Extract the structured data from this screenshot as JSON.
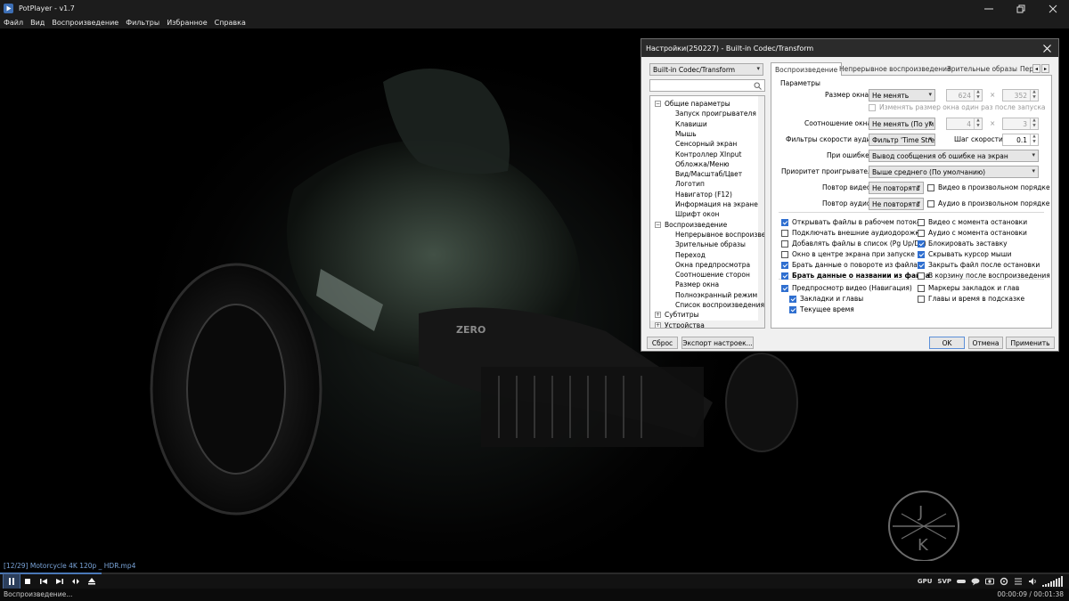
{
  "window": {
    "title": "PotPlayer - v1.7"
  },
  "menu": [
    "Файл",
    "Вид",
    "Воспроизведение",
    "Фильтры",
    "Избранное",
    "Справка"
  ],
  "video": {
    "watermark_letters": [
      "J",
      "K"
    ]
  },
  "filename": "[12/29] Motorcycle 4K 120p _ HDR.mp4",
  "progress": {
    "fraction": 0.095
  },
  "controls": {
    "right_labels": [
      "GPU",
      "SVP"
    ]
  },
  "status": {
    "left": "Воспроизведение...",
    "time": "00:00:09 / 00:01:38"
  },
  "dialog": {
    "title": "Настройки(250227) - Built-in Codec/Transform",
    "profile_combo": "Built-in Codec/Transform",
    "search_placeholder": "",
    "tree": [
      {
        "label": "Общие параметры",
        "level": 0,
        "toggle": "−"
      },
      {
        "label": "Запуск проигрывателя",
        "level": 1
      },
      {
        "label": "Клавиши",
        "level": 1
      },
      {
        "label": "Мышь",
        "level": 1
      },
      {
        "label": "Сенсорный экран",
        "level": 1
      },
      {
        "label": "Контроллер XInput",
        "level": 1
      },
      {
        "label": "Обложка/Меню",
        "level": 1
      },
      {
        "label": "Вид/Масштаб/Цвет",
        "level": 1
      },
      {
        "label": "Логотип",
        "level": 1
      },
      {
        "label": "Навигатор (F12)",
        "level": 1
      },
      {
        "label": "Информация на экране",
        "level": 1
      },
      {
        "label": "Шрифт окон",
        "level": 1
      },
      {
        "label": "Воспроизведение",
        "level": 0,
        "toggle": "−"
      },
      {
        "label": "Непрерывное воспроизве",
        "level": 1
      },
      {
        "label": "Зрительные образы",
        "level": 1
      },
      {
        "label": "Переход",
        "level": 1
      },
      {
        "label": "Окна предпросмотра",
        "level": 1
      },
      {
        "label": "Соотношение сторон",
        "level": 1
      },
      {
        "label": "Размер окна",
        "level": 1
      },
      {
        "label": "Полноэкранный режим",
        "level": 1
      },
      {
        "label": "Список воспроизведения",
        "level": 1
      },
      {
        "label": "Субтитры",
        "level": 0,
        "toggle": "+"
      },
      {
        "label": "Устройства",
        "level": 0,
        "toggle": "+"
      }
    ],
    "tabs": [
      "Воспроизведение",
      "Непрерывное воспроизведение",
      "Зрительные образы",
      "Пер"
    ],
    "group_title": "Параметры",
    "window_size": {
      "label": "Размер окна:",
      "value": "Не менять",
      "width": "624",
      "height": "352",
      "x_sep": "×",
      "resize_once": "Изменять размер окна один раз после запуска"
    },
    "aspect": {
      "label": "Соотношение окна:",
      "value": "Не менять (По ум",
      "w": "4",
      "h": "3",
      "x_sep": "×"
    },
    "audio_filter": {
      "label": "Фильтры скорости аудио:",
      "value": "Фильтр 'Time Stre",
      "step_label": "Шаг скорости:",
      "step_value": "0.1"
    },
    "on_error": {
      "label": "При ошибке:",
      "value": "Вывод сообщения об ошибке на экран"
    },
    "priority": {
      "label": "Приоритет проигрывателя:",
      "value": "Выше среднего (По умолчанию)"
    },
    "repeat_video": {
      "label": "Повтор видео:",
      "value": "Не повторять",
      "random_label": "Видео в произвольном порядке"
    },
    "repeat_audio": {
      "label": "Повтор аудио:",
      "value": "Не повторять",
      "random_label": "Аудио в произвольном порядке"
    },
    "checks_left": [
      {
        "label": "Открывать файлы в рабочем потоке",
        "checked": true
      },
      {
        "label": "Подключать внешние аудиодорожки",
        "checked": false
      },
      {
        "label": "Добавлять файлы в список (Pg Up/Dn)",
        "checked": false
      },
      {
        "label": "Окно в центре экрана при запуске",
        "checked": false
      },
      {
        "label": "Брать данные о повороте из файла",
        "checked": true
      },
      {
        "label": "Брать данные о названии из файла",
        "checked": true,
        "bold": true
      }
    ],
    "checks_right": [
      {
        "label": "Видео с момента остановки",
        "checked": false
      },
      {
        "label": "Аудио с момента остановки",
        "checked": false
      },
      {
        "label": "Блокировать заставку",
        "checked": true
      },
      {
        "label": "Скрывать курсор мыши",
        "checked": true
      },
      {
        "label": "Закрыть файл после остановки",
        "checked": true
      },
      {
        "label": "В корзину после воспроизведения",
        "checked": false
      }
    ],
    "preview": {
      "label": "Предпросмотр видео (Навигация)",
      "checked": true
    },
    "bookmarks": {
      "label": "Закладки и главы",
      "checked": true
    },
    "current_time": {
      "label": "Текущее время",
      "checked": true
    },
    "markers": {
      "label": "Маркеры закладок и глав",
      "checked": false
    },
    "chapters_tooltip": {
      "label": "Главы и время в подсказке",
      "checked": false
    },
    "buttons": {
      "reset": "Сброс",
      "export": "Экспорт настроек...",
      "ok": "OK",
      "cancel": "Отмена",
      "apply": "Применить"
    }
  }
}
